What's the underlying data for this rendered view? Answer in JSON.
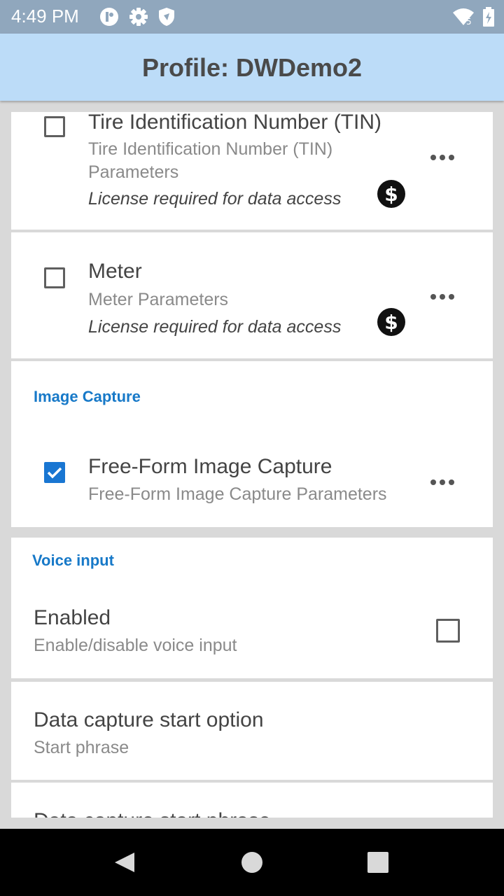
{
  "status_bar": {
    "time": "4:49 PM",
    "battery_level": "5"
  },
  "app_bar": {
    "title": "Profile: DWDemo2"
  },
  "items": {
    "tin": {
      "title": "Tire Identification Number (TIN)",
      "subtitle_line1": "Tire Identification Number (TIN)",
      "subtitle_line2": "Parameters",
      "license": "License required for data access",
      "checked": false
    },
    "meter": {
      "title": "Meter",
      "subtitle": "Meter Parameters",
      "license": "License required for data access",
      "checked": false
    }
  },
  "image_capture": {
    "header": "Image Capture",
    "title": "Free-Form Image Capture",
    "subtitle": "Free-Form Image Capture Parameters",
    "checked": true
  },
  "voice_input": {
    "header": "Voice input",
    "enabled_title": "Enabled",
    "enabled_subtitle": "Enable/disable voice input",
    "enabled_checked": false,
    "start_option_title": "Data capture start option",
    "start_option_subtitle": "Start phrase",
    "start_phrase_title": "Data capture start phrase"
  },
  "colors": {
    "accent": "#1779c8",
    "app_bar": "#bcdcf8",
    "status_bar": "#90a7bd",
    "checkbox_checked": "#1976d2"
  },
  "icons": [
    "notification-icon",
    "settings-gear-icon",
    "shield-icon",
    "wifi-icon",
    "battery-icon",
    "more-options-icon",
    "license-dollar-icon",
    "back-nav-icon",
    "home-nav-icon",
    "recents-nav-icon"
  ]
}
